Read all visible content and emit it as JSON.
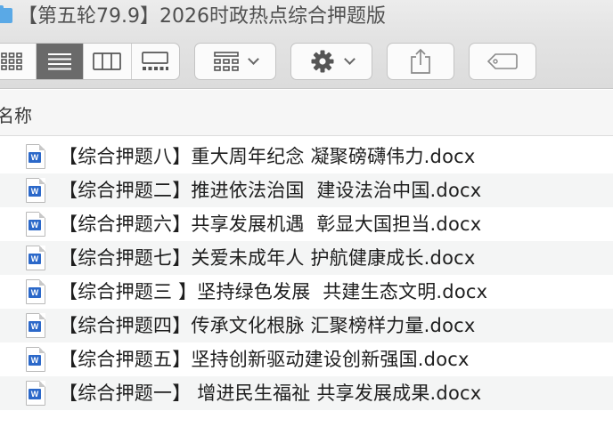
{
  "window": {
    "title": "【第五轮79.9】2026时政热点综合押题版"
  },
  "toolbar": {
    "view_modes": [
      {
        "icon": "icon-view-icon",
        "active": false
      },
      {
        "icon": "list-view-icon",
        "active": true
      },
      {
        "icon": "column-view-icon",
        "active": false
      },
      {
        "icon": "gallery-view-icon",
        "active": false
      }
    ],
    "group_icon": "group-grid-icon",
    "action_icon": "gear-icon",
    "share_icon": "share-icon",
    "tag_icon": "tag-icon"
  },
  "columns": {
    "name": "名称"
  },
  "files": [
    {
      "name": "【综合押题八】重大周年纪念 凝聚磅礴伟力.docx",
      "icon": "word-doc-icon"
    },
    {
      "name": "【综合押题二】推进依法治国  建设法治中国.docx",
      "icon": "word-doc-icon"
    },
    {
      "name": "【综合押题六】共享发展机遇  彰显大国担当.docx",
      "icon": "word-doc-icon"
    },
    {
      "name": "【综合押题七】关爱未成年人 护航健康成长.docx",
      "icon": "word-doc-icon"
    },
    {
      "name": "【综合押题三 】坚持绿色发展  共建生态文明.docx",
      "icon": "word-doc-icon"
    },
    {
      "name": "【综合押题四】传承文化根脉 汇聚榜样力量.docx",
      "icon": "word-doc-icon"
    },
    {
      "name": "【综合押题五】坚持创新驱动建设创新强国.docx",
      "icon": "word-doc-icon"
    },
    {
      "name": "【综合押题一】 增进民生福祉 共享发展成果.docx",
      "icon": "word-doc-icon"
    }
  ],
  "colors": {
    "selected_segment": "#6a6a6a",
    "word_blue": "#2b68c9",
    "folder_blue": "#5aa9e6",
    "row_stripe": "#f4f5f5"
  }
}
